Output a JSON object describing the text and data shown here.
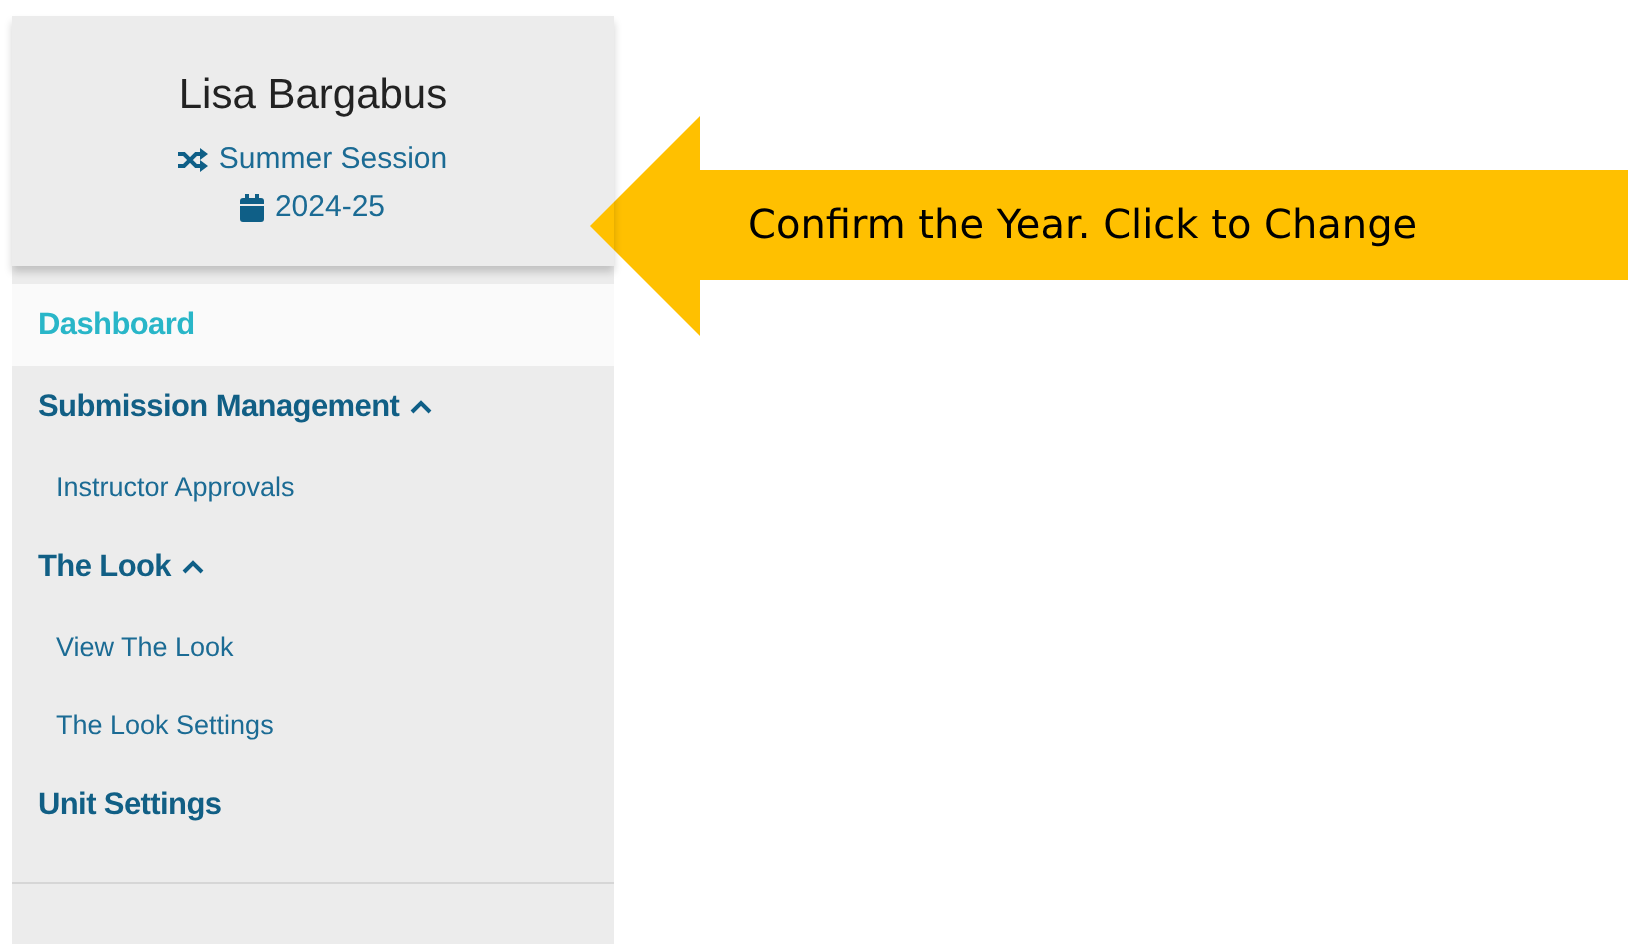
{
  "profile": {
    "name": "Lisa Bargabus",
    "session": "Summer Session",
    "year": "2024-25"
  },
  "menu": [
    {
      "label": "Dashboard",
      "kind": "link",
      "selected": true
    },
    {
      "label": "Submission Management",
      "kind": "group",
      "selected": false,
      "expanded": true,
      "children": [
        {
          "label": "Instructor Approvals",
          "selected": false
        }
      ]
    },
    {
      "label": "The Look",
      "kind": "group",
      "selected": false,
      "expanded": true,
      "children": [
        {
          "label": "View The Look",
          "selected": false
        },
        {
          "label": "The Look Settings",
          "selected": false
        }
      ]
    },
    {
      "label": "Unit Settings",
      "kind": "link",
      "selected": false
    }
  ],
  "callout": {
    "text": "Confirm the Year. Click to Change"
  }
}
